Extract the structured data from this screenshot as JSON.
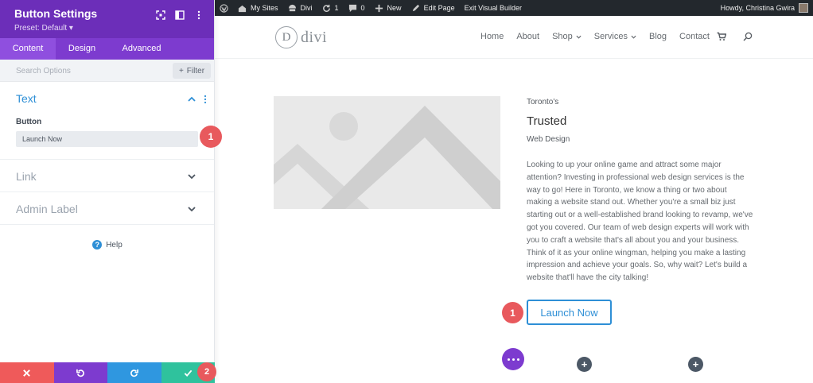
{
  "panel": {
    "title": "Button Settings",
    "preset": "Preset: Default ▾",
    "tabs": [
      "Content",
      "Design",
      "Advanced"
    ],
    "search_placeholder": "Search Options",
    "filter_label": "Filter",
    "sections": {
      "text": {
        "title": "Text",
        "field_label": "Button",
        "field_value": "Launch Now"
      },
      "link": {
        "title": "Link"
      },
      "admin": {
        "title": "Admin Label"
      }
    },
    "help_label": "Help",
    "badges": {
      "one": "1",
      "two": "2"
    }
  },
  "admin_bar": {
    "my_sites": "My Sites",
    "site": "Divi",
    "updates": "1",
    "comments": "0",
    "new": "New",
    "edit_page": "Edit Page",
    "exit_builder": "Exit Visual Builder",
    "howdy": "Howdy, Christina Gwira"
  },
  "site": {
    "logo_letter": "D",
    "logo_text": "divi",
    "nav": [
      {
        "label": "Home",
        "dropdown": false
      },
      {
        "label": "About",
        "dropdown": false
      },
      {
        "label": "Shop",
        "dropdown": true
      },
      {
        "label": "Services",
        "dropdown": true
      },
      {
        "label": "Blog",
        "dropdown": false
      },
      {
        "label": "Contact",
        "dropdown": false
      }
    ]
  },
  "content": {
    "city": "Toronto's",
    "headline": "Trusted",
    "subhead": "Web Design",
    "body": "Looking to up your online game and attract some major attention? Investing in professional web design services is the way to go! Here in Toronto, we know a thing or two about making a website stand out. Whether you're a small biz just starting out or a well-established brand looking to revamp, we've got you covered. Our team of web design experts will work with you to craft a website that's all about you and your business. Think of it as your online wingman, helping you make a lasting impression and achieve your goals. So, why wait? Let's build a website that'll have the city talking!",
    "cta_label": "Launch Now",
    "cta_badge": "1",
    "add_symbol": "+"
  },
  "colors": {
    "panel_header": "#6c2eb9",
    "panel_tabs": "#7d3bcf",
    "accent_blue": "#2e8fd6",
    "badge_red": "#e8595d",
    "discard": "#ef5a5a",
    "undo": "#7d3bcf",
    "redo": "#2f97e0",
    "save": "#2fc29d"
  }
}
